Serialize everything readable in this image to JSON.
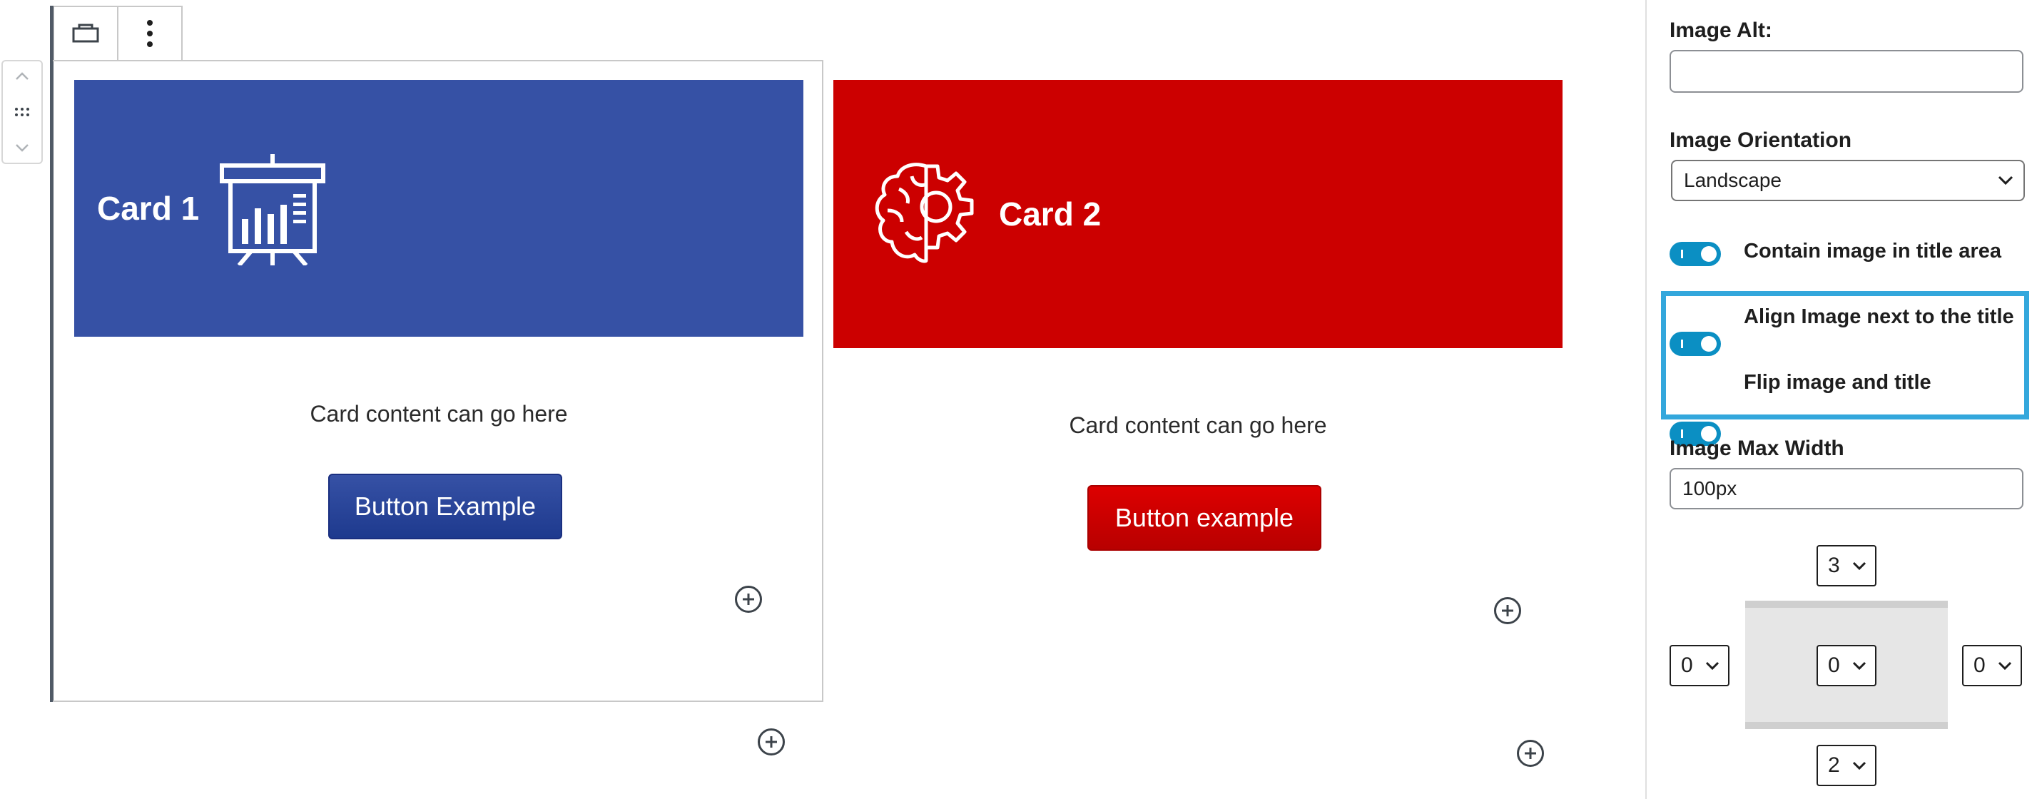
{
  "editor": {
    "card1": {
      "title": "Card 1",
      "content": "Card content can go here",
      "button_label": "Button Example",
      "color": "#3651a5",
      "icon": "presentation-chart-icon"
    },
    "card2": {
      "title": "Card 2",
      "content": "Card content can go here",
      "button_label": "Button example",
      "color": "#cc0000",
      "icon": "brain-gear-icon"
    }
  },
  "sidebar": {
    "image_alt_label": "Image Alt:",
    "image_alt_value": "",
    "orientation_label": "Image Orientation",
    "orientation_value": "Landscape",
    "toggles": [
      {
        "label": "Contain image in title area",
        "checked": true
      },
      {
        "label": "Align Image next to the title",
        "checked": true
      },
      {
        "label": "Flip image and title",
        "checked": true
      }
    ],
    "max_width_label": "Image Max Width",
    "max_width_value": "100px",
    "spacing": {
      "top": "3",
      "left": "0",
      "center": "0",
      "right": "0",
      "bottom": "2"
    },
    "accent_color": "#0b8fc3",
    "highlight_color": "#33a7dc"
  }
}
